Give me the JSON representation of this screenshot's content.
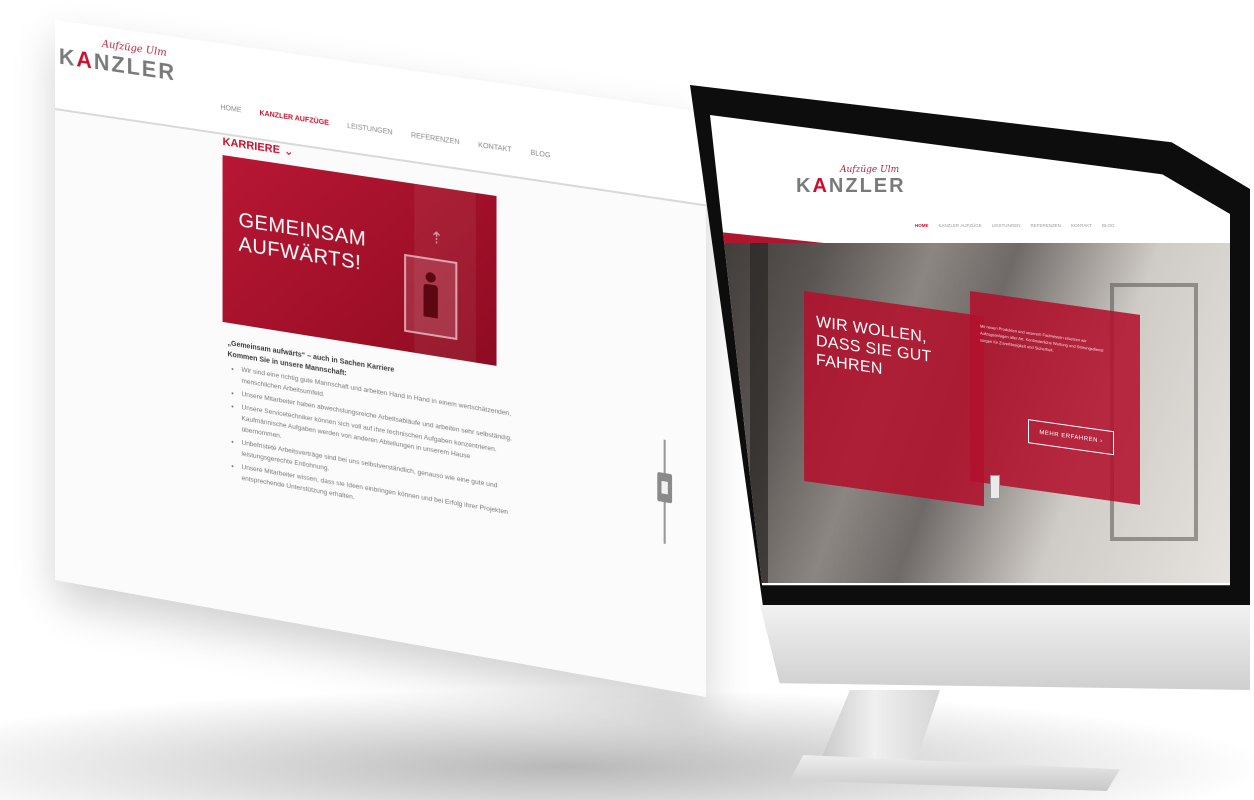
{
  "brand": {
    "tagline": "Aufzüge Ulm",
    "word_prefix": "K",
    "word_accent": "A",
    "word_suffix": "NZLER",
    "accent_color": "#c8102e",
    "gray_color": "#7a7a7a"
  },
  "left_page": {
    "nav": [
      "HOME",
      "KANZLER AUFZÜGE",
      "LEISTUNGEN",
      "REFERENZEN",
      "KONTAKT",
      "BLOG"
    ],
    "nav_active_index": 1,
    "section_title": "KARRIERE",
    "section_icon": "chevron-down-icon",
    "hero_title_line1": "GEMEINSAM",
    "hero_title_line2": "AUFWÄRTS!",
    "lead_line1": "„Gemeinsam aufwärts“ – auch in Sachen Karriere",
    "lead_line2": "Kommen Sie in unsere Mannschaft:",
    "bullets": [
      "Wir sind eine richtig gute Mannschaft und arbeiten Hand in Hand in einem wertschätzenden, menschlichen Arbeitsumfeld.",
      "Unsere Mitarbeiter haben abwechslungsreiche Arbeitsabläufe und arbeiten sehr selbständig.",
      "Unsere Servicetechniker können sich voll auf ihre technischen Aufgaben konzentrieren. Kaufmännische Aufgaben werden von anderen Abteilungen in unserem Hause übernommen.",
      "Unbefristete Arbeitsverträge sind bei uns selbstverständlich, genauso wie eine gute und leistungsgerechte Entlohnung.",
      "Unsere Mitarbeiter wissen, dass sie Ideen einbringen können und bei Erfolg ihrer Projekten entsprechende Unterstützung erhalten."
    ]
  },
  "monitor_page": {
    "nav": [
      "HOME",
      "KANZLER AUFZÜGE",
      "LEISTUNGEN",
      "REFERENZEN",
      "KONTAKT",
      "BLOG"
    ],
    "nav_active_index": 0,
    "promo_line1": "WIR WOLLEN,",
    "promo_line2": "DASS SIE GUT",
    "promo_line3": "FAHREN",
    "info_text": "Mit neuen Produkten und unserem Fachwissen ersetzen wir Aufzugsanlagen aller Art. Kontinuierliche Wartung und Störungsdienst sorgen für Zuverlässigkeit und Sicherheit.",
    "button_label": "MEHR ERFAHREN ›"
  }
}
